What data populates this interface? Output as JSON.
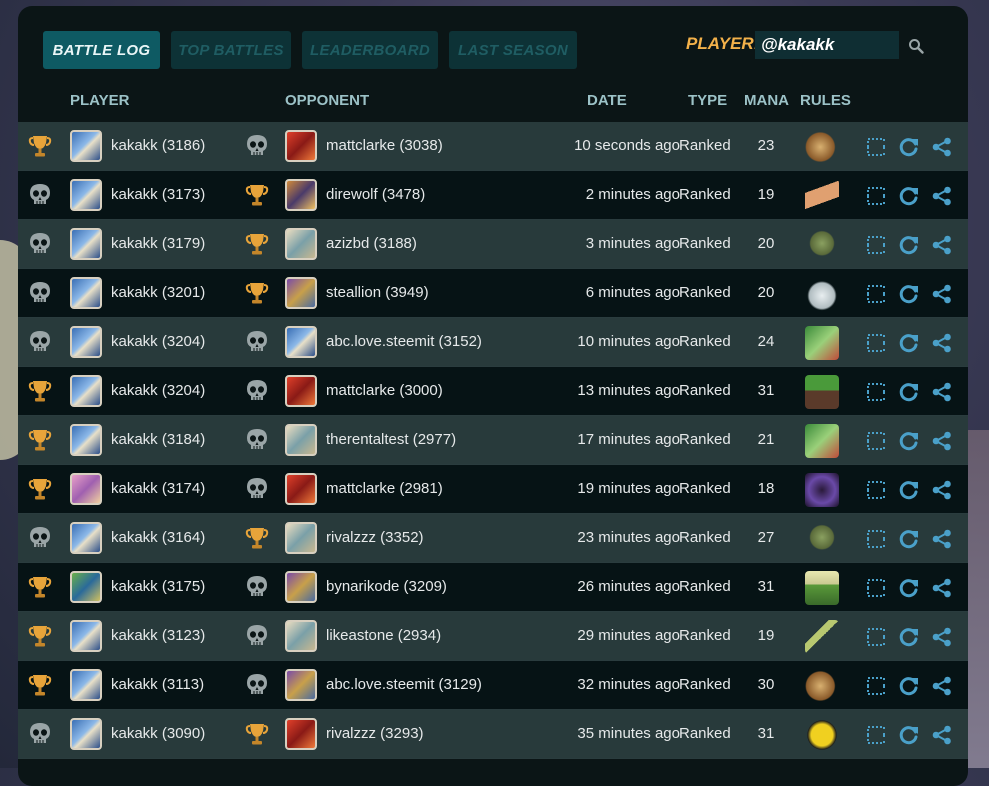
{
  "tabs": [
    {
      "label": "BATTLE LOG",
      "active": true
    },
    {
      "label": "TOP BATTLES",
      "active": false
    },
    {
      "label": "LEADERBOARD",
      "active": false
    },
    {
      "label": "LAST SEASON",
      "active": false
    }
  ],
  "player_label": "PLAYER:",
  "player_value": "@kakakk",
  "columns": {
    "player": "PLAYER",
    "opponent": "OPPONENT",
    "date": "DATE",
    "type": "TYPE",
    "mana": "MANA",
    "rules": "RULES"
  },
  "colors": {
    "accent": "#0e5a63",
    "win": "#e8a43a",
    "loss": "#9aa5a7",
    "action": "#4aa0c9"
  },
  "battles": [
    {
      "p_result": "win",
      "player": "kakakk (3186)",
      "p_av": "blue",
      "o_result": "loss",
      "opponent": "mattclarke (3038)",
      "o_av": "red",
      "date": "10 seconds ago",
      "type": "Ranked",
      "mana": "23",
      "rule": "tan"
    },
    {
      "p_result": "loss",
      "player": "kakakk (3173)",
      "p_av": "blue",
      "o_result": "win",
      "opponent": "direwolf (3478)",
      "o_av": "orange",
      "date": "2 minutes ago",
      "type": "Ranked",
      "mana": "19",
      "rule": "bandage"
    },
    {
      "p_result": "loss",
      "player": "kakakk (3179)",
      "p_av": "blue",
      "o_result": "win",
      "opponent": "azizbd (3188)",
      "o_av": "pale",
      "date": "3 minutes ago",
      "type": "Ranked",
      "mana": "20",
      "rule": "goblin"
    },
    {
      "p_result": "loss",
      "player": "kakakk (3201)",
      "p_av": "blue",
      "o_result": "win",
      "opponent": "steallion (3949)",
      "o_av": "purple",
      "date": "6 minutes ago",
      "type": "Ranked",
      "mana": "20",
      "rule": "cloud"
    },
    {
      "p_result": "loss",
      "player": "kakakk (3204)",
      "p_av": "blue",
      "o_result": "loss",
      "opponent": "abc.love.steemit (3152)",
      "o_av": "blue",
      "date": "10 minutes ago",
      "type": "Ranked",
      "mana": "24",
      "rule": "green"
    },
    {
      "p_result": "win",
      "player": "kakakk (3204)",
      "p_av": "blue",
      "o_result": "loss",
      "opponent": "mattclarke (3000)",
      "o_av": "red",
      "date": "13 minutes ago",
      "type": "Ranked",
      "mana": "31",
      "rule": "plant"
    },
    {
      "p_result": "win",
      "player": "kakakk (3184)",
      "p_av": "blue",
      "o_result": "loss",
      "opponent": "therentaltest (2977)",
      "o_av": "pale",
      "date": "17 minutes ago",
      "type": "Ranked",
      "mana": "21",
      "rule": "green"
    },
    {
      "p_result": "win",
      "player": "kakakk (3174)",
      "p_av": "pink",
      "o_result": "loss",
      "opponent": "mattclarke (2981)",
      "o_av": "red",
      "date": "19 minutes ago",
      "type": "Ranked",
      "mana": "18",
      "rule": "hood"
    },
    {
      "p_result": "loss",
      "player": "kakakk (3164)",
      "p_av": "blue",
      "o_result": "win",
      "opponent": "rivalzzz (3352)",
      "o_av": "pale",
      "date": "23 minutes ago",
      "type": "Ranked",
      "mana": "27",
      "rule": "goblin"
    },
    {
      "p_result": "win",
      "player": "kakakk (3175)",
      "p_av": "green",
      "o_result": "loss",
      "opponent": "bynarikode (3209)",
      "o_av": "purple",
      "date": "26 minutes ago",
      "type": "Ranked",
      "mana": "31",
      "rule": "mountain"
    },
    {
      "p_result": "win",
      "player": "kakakk (3123)",
      "p_av": "blue",
      "o_result": "loss",
      "opponent": "likeastone (2934)",
      "o_av": "pale",
      "date": "29 minutes ago",
      "type": "Ranked",
      "mana": "19",
      "rule": "lightning"
    },
    {
      "p_result": "win",
      "player": "kakakk (3113)",
      "p_av": "blue",
      "o_result": "loss",
      "opponent": "abc.love.steemit (3129)",
      "o_av": "purple",
      "date": "32 minutes ago",
      "type": "Ranked",
      "mana": "30",
      "rule": "tan"
    },
    {
      "p_result": "loss",
      "player": "kakakk (3090)",
      "p_av": "blue",
      "o_result": "win",
      "opponent": "rivalzzz (3293)",
      "o_av": "red",
      "date": "35 minutes ago",
      "type": "Ranked",
      "mana": "31",
      "rule": "yellow"
    }
  ]
}
